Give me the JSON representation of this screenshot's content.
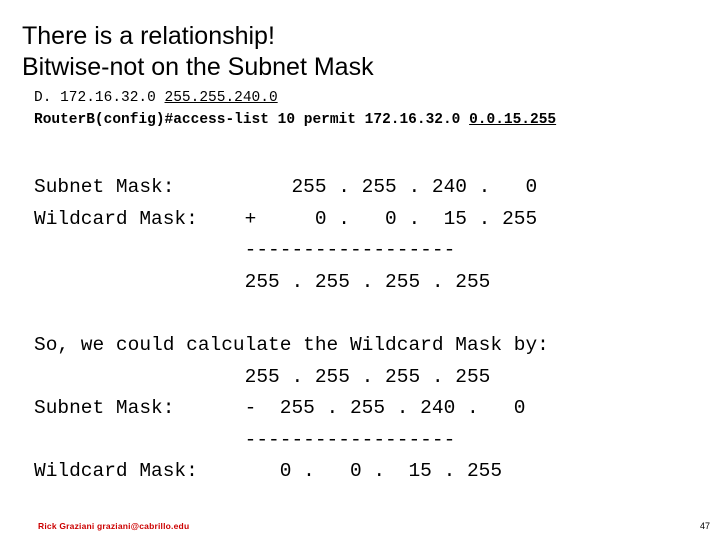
{
  "slide": {
    "title": "There is a relationship!\nBitwise-not on the Subnet Mask",
    "code": {
      "line1_prefix": "D. 172.16.32.0 ",
      "line1_underlined": "255.255.240.0",
      "line2_prefix": "Router",
      "line2_mid": "B(config)#access-list 10 permit 172.16.32.0 ",
      "line2_underlined": "0.0.15.255"
    },
    "calc_add": "Subnet Mask:          255 . 255 . 240 .   0\nWildcard Mask:    +     0 .   0 .  15 . 255\n                  ------------------\n                  255 . 255 . 255 . 255",
    "calc_sub": "So, we could calculate the Wildcard Mask by:\n                  255 . 255 . 255 . 255\nSubnet Mask:      -  255 . 255 . 240 .   0\n                  ------------------\nWildcard Mask:       0 .   0 .  15 . 255",
    "footer": "Rick Graziani  graziani@cabrillo.edu",
    "page_number": "47"
  }
}
